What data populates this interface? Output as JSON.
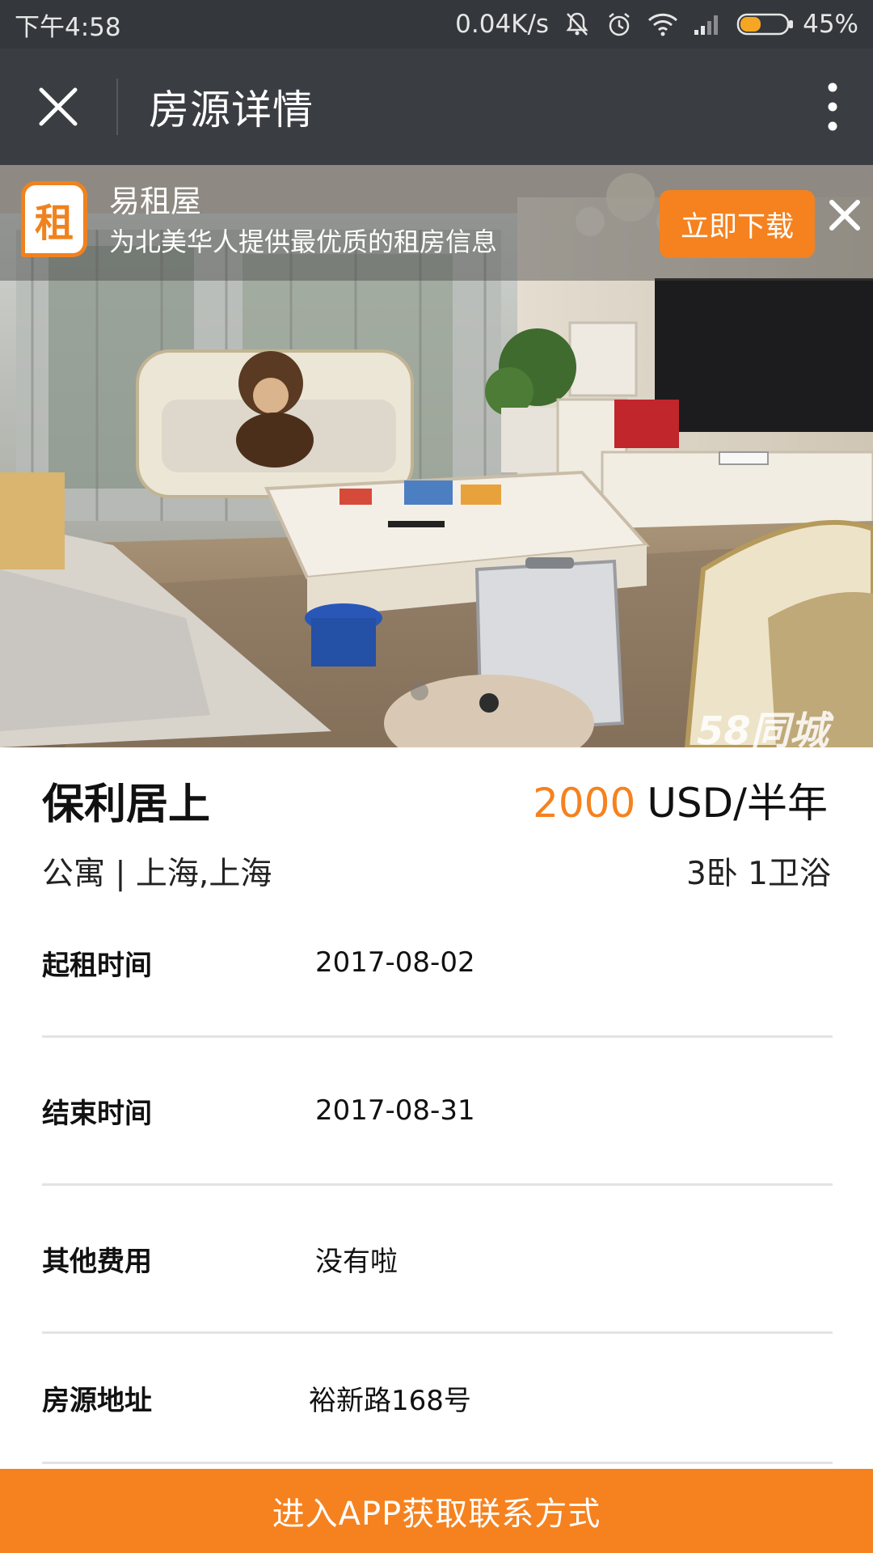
{
  "status_bar": {
    "time": "下午4:58",
    "network_speed": "0.04K/s",
    "battery_percent": "45%",
    "battery_level": 0.45,
    "icons": [
      "mute-icon",
      "alarm-icon",
      "wifi-icon",
      "signal-icon",
      "battery-icon"
    ]
  },
  "titlebar": {
    "title": "房源详情",
    "close_icon": "close-icon",
    "more_icon": "more-vertical-icon"
  },
  "banner": {
    "logo_text": "租",
    "app_name": "易租屋",
    "description": "为北美华人提供最优质的租房信息",
    "download_label": "立即下载"
  },
  "hero": {
    "watermark": "58同城"
  },
  "listing": {
    "name": "保利居上",
    "price": "2000",
    "price_unit": "USD/半年",
    "type_location": "公寓 | 上海,上海",
    "rooms": "3卧 1卫浴"
  },
  "details": [
    {
      "label": "起租时间",
      "value": "2017-08-02"
    },
    {
      "label": "结束时间",
      "value": "2017-08-31"
    },
    {
      "label": "其他费用",
      "value": "没有啦"
    },
    {
      "label": "房源地址",
      "value": "裕新路168号"
    }
  ],
  "cta": {
    "label": "进入APP获取联系方式"
  },
  "colors": {
    "accent": "#f5821f",
    "statusbar_bg": "#34373b",
    "titlebar_bg": "#3a3d42"
  }
}
